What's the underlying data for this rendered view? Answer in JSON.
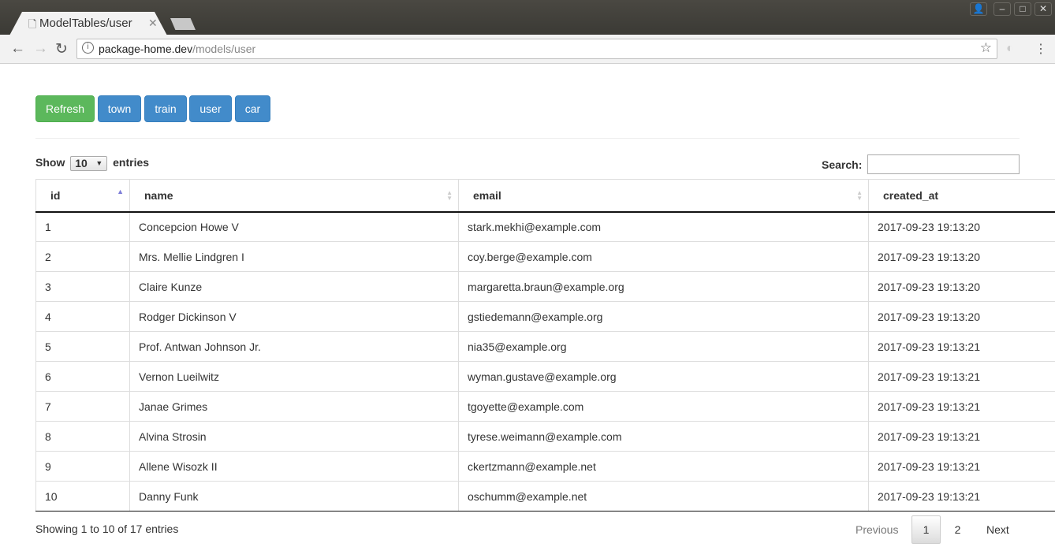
{
  "browser": {
    "tab_title": "ModelTables/user",
    "url_host": "package-home.dev",
    "url_path": "/models/user"
  },
  "buttons": [
    {
      "label": "Refresh",
      "color": "#5cb85c"
    },
    {
      "label": "town",
      "color": "#428bca"
    },
    {
      "label": "train",
      "color": "#428bca"
    },
    {
      "label": "user",
      "color": "#428bca"
    },
    {
      "label": "car",
      "color": "#428bca"
    }
  ],
  "controls": {
    "show_label": "Show",
    "entries_value": "10",
    "entries_label": "entries",
    "search_label": "Search:",
    "search_value": ""
  },
  "table": {
    "columns": [
      "id",
      "name",
      "email",
      "created_at"
    ],
    "sorted_column": "id",
    "sort_direction": "ascending",
    "rows": [
      [
        "1",
        "Concepcion Howe V",
        "stark.mekhi@example.com",
        "2017-09-23 19:13:20"
      ],
      [
        "2",
        "Mrs. Mellie Lindgren I",
        "coy.berge@example.com",
        "2017-09-23 19:13:20"
      ],
      [
        "3",
        "Claire Kunze",
        "margaretta.braun@example.org",
        "2017-09-23 19:13:20"
      ],
      [
        "4",
        "Rodger Dickinson V",
        "gstiedemann@example.org",
        "2017-09-23 19:13:20"
      ],
      [
        "5",
        "Prof. Antwan Johnson Jr.",
        "nia35@example.org",
        "2017-09-23 19:13:21"
      ],
      [
        "6",
        "Vernon Lueilwitz",
        "wyman.gustave@example.org",
        "2017-09-23 19:13:21"
      ],
      [
        "7",
        "Janae Grimes",
        "tgoyette@example.com",
        "2017-09-23 19:13:21"
      ],
      [
        "8",
        "Alvina Strosin",
        "tyrese.weimann@example.com",
        "2017-09-23 19:13:21"
      ],
      [
        "9",
        "Allene Wisozk II",
        "ckertzmann@example.net",
        "2017-09-23 19:13:21"
      ],
      [
        "10",
        "Danny Funk",
        "oschumm@example.net",
        "2017-09-23 19:13:21"
      ]
    ]
  },
  "footer": {
    "info": "Showing 1 to 10 of 17 entries",
    "previous": "Previous",
    "pages": [
      "1",
      "2"
    ],
    "current_page": "1",
    "next": "Next"
  }
}
